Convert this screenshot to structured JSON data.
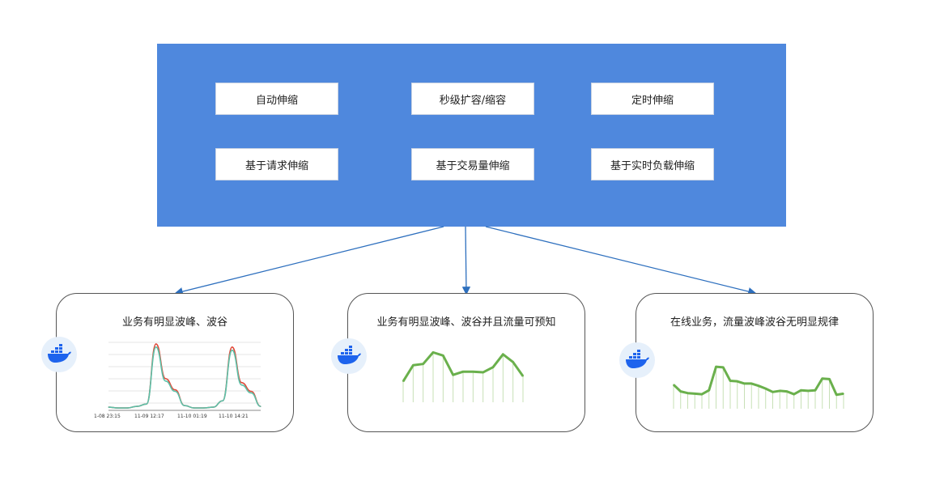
{
  "panel": {
    "color": "#4f88dd",
    "buttons": [
      {
        "label": "自动伸缩"
      },
      {
        "label": "秒级扩容/缩容"
      },
      {
        "label": "定时伸缩"
      },
      {
        "label": "基于请求伸缩"
      },
      {
        "label": "基于交易量伸缩"
      },
      {
        "label": "基于实时负载伸缩"
      }
    ]
  },
  "cards": [
    {
      "title": "业务有明显波峰、波谷",
      "icon": "docker-whale-icon",
      "x_ticks": [
        "1-08 23:15",
        "11-09 12:17",
        "11-10 01:19",
        "11-10 14:21"
      ]
    },
    {
      "title": "业务有明显波峰、波谷并且流量可预知",
      "icon": "docker-whale-icon"
    },
    {
      "title": "在线业务，流量波峰波谷无明显规律",
      "icon": "docker-whale-icon"
    }
  ],
  "chart_data": [
    {
      "type": "line",
      "x": [
        "1-08 23:15",
        "11-09 12:17",
        "11-10 01:19",
        "11-10 14:21"
      ],
      "series": [
        {
          "values": [
            2,
            1,
            1,
            3,
            6,
            78,
            35,
            22,
            4,
            1,
            1,
            2,
            10,
            74,
            30,
            20,
            3
          ]
        },
        {
          "values": [
            2,
            1,
            1,
            3,
            6,
            82,
            38,
            24,
            4,
            1,
            1,
            2,
            10,
            78,
            33,
            22,
            3
          ]
        }
      ],
      "colors": [
        "#5cc0a8",
        "#e04a3a"
      ]
    },
    {
      "type": "line",
      "values": [
        30,
        55,
        57,
        75,
        70,
        40,
        45,
        45,
        44,
        52,
        72,
        60,
        38
      ],
      "colors": [
        "#6ab04c"
      ]
    },
    {
      "type": "line",
      "values": [
        40,
        28,
        25,
        24,
        23,
        30,
        72,
        71,
        47,
        46,
        42,
        42,
        38,
        33,
        27,
        29,
        28,
        23,
        30,
        29,
        30,
        51,
        50,
        22,
        24
      ],
      "colors": [
        "#6ab04c"
      ]
    }
  ]
}
